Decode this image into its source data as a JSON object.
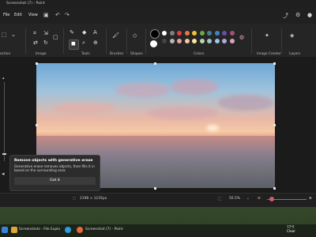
{
  "window": {
    "title": "Screenshot (7) - Paint"
  },
  "menu": {
    "file": "File",
    "edit": "Edit",
    "view": "View"
  },
  "ribbon": {
    "groups": {
      "selection": "ection",
      "image": "Image",
      "tools": "Tools",
      "brushes": "Brushes",
      "shapes": "Shapes",
      "colors": "Colors",
      "image_creator": "Image Creator",
      "layers": "Layers"
    },
    "palette": [
      "#ffffff",
      "#7f7f7f",
      "#e0403f",
      "#e07b3f",
      "#f1c232",
      "#6aa84f",
      "#45818e",
      "#3d85c6",
      "#674ea7",
      "#a64d79",
      "#444444",
      "#b7b7b7",
      "#e8a0a0",
      "#f2c9a0",
      "#f9e79f",
      "#b6d7a8",
      "#a2c4c9",
      "#9fc5e8",
      "#b4a7d6",
      "#d5a6bd"
    ]
  },
  "tooltip": {
    "heading": "Remove objects with generative erase",
    "body": "Generative erase removes objects, then fills it in based on the surrounding area",
    "button": "Got it"
  },
  "status": {
    "dimensions": "2198 × 1235px",
    "zoom": "50.5%"
  },
  "taskbar": {
    "item1": "Screenshots - File Explo",
    "item2": "Screenshot (7) - Paint",
    "temp": "77°F",
    "weather": "Clear"
  }
}
